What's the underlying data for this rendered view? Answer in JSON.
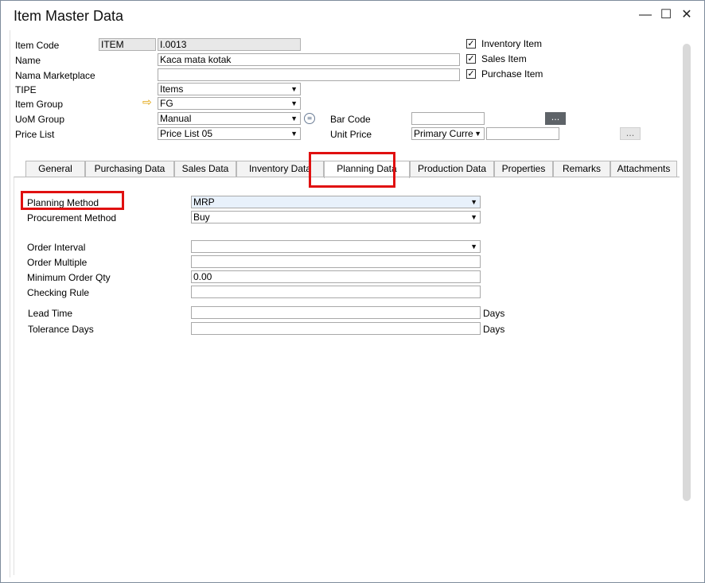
{
  "window": {
    "title": "Item Master Data",
    "minimize": "—",
    "maximize": "☐",
    "close": "✕"
  },
  "header": {
    "item_code_label": "Item Code",
    "item_code_series": "ITEM",
    "item_code_value": "I.0013",
    "name_label": "Name",
    "name_value": "Kaca mata kotak",
    "marketplace_label": "Nama Marketplace",
    "marketplace_value": "",
    "tipe_label": "TIPE",
    "tipe_value": "Items",
    "item_group_label": "Item Group",
    "item_group_value": "FG",
    "uom_group_label": "UoM Group",
    "uom_group_value": "Manual",
    "price_list_label": "Price List",
    "price_list_value": "Price List 05",
    "bar_code_label": "Bar Code",
    "bar_code_value": "",
    "unit_price_label": "Unit Price",
    "unit_price_currency": "Primary Curre",
    "unit_price_value": "",
    "ellipsis": "...",
    "inventory_item_label": "Inventory Item",
    "sales_item_label": "Sales Item",
    "purchase_item_label": "Purchase Item",
    "check_mark": "✓"
  },
  "tabs": [
    {
      "label": "General"
    },
    {
      "label": "Purchasing Data"
    },
    {
      "label": "Sales Data"
    },
    {
      "label": "Inventory Data"
    },
    {
      "label": "Planning Data"
    },
    {
      "label": "Production Data"
    },
    {
      "label": "Properties"
    },
    {
      "label": "Remarks"
    },
    {
      "label": "Attachments"
    }
  ],
  "planning": {
    "planning_method_label": "Planning Method",
    "planning_method_value": "MRP",
    "procurement_method_label": "Procurement Method",
    "procurement_method_value": "Buy",
    "order_interval_label": "Order Interval",
    "order_interval_value": "",
    "order_multiple_label": "Order Multiple",
    "order_multiple_value": "",
    "min_order_qty_label": "Minimum Order Qty",
    "min_order_qty_value": "0.00",
    "checking_rule_label": "Checking Rule",
    "checking_rule_value": "",
    "lead_time_label": "Lead Time",
    "lead_time_value": "",
    "tolerance_days_label": "Tolerance Days",
    "tolerance_days_value": "",
    "days_unit": "Days"
  },
  "colors": {
    "highlight": "#e01010",
    "arrow": "#e0a000"
  }
}
